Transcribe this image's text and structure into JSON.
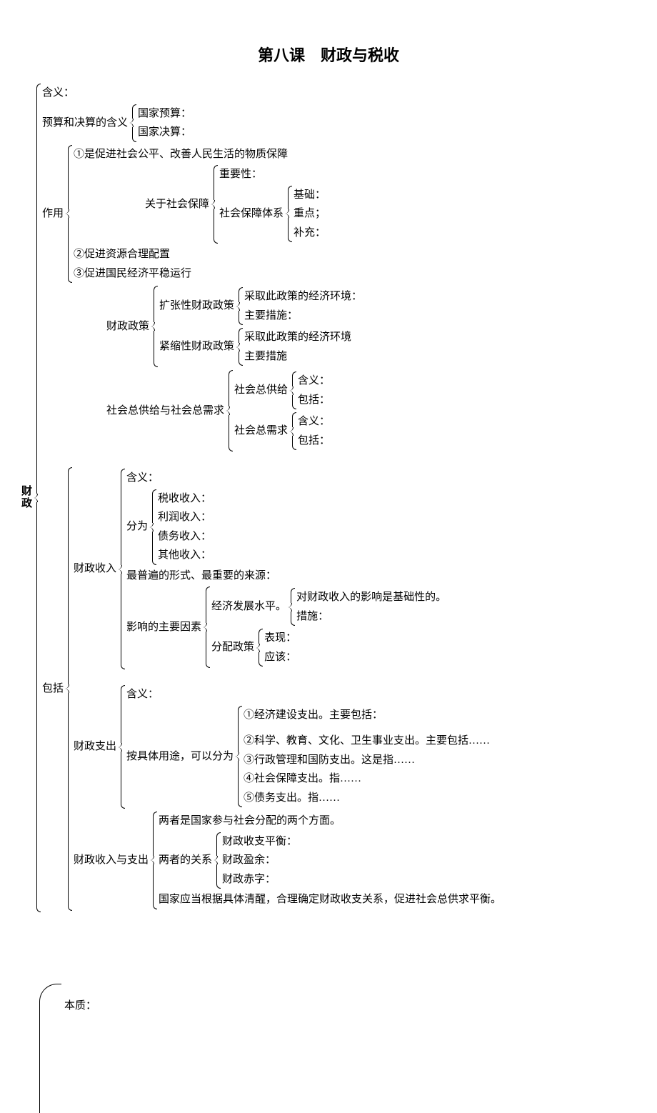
{
  "title": "第八课　财政与税收",
  "root": "财政",
  "s1": {
    "meaning": "含义：",
    "budget": {
      "label": "预算和决算的含义",
      "a": "国家预算：",
      "b": "国家决算："
    },
    "role": {
      "label": "作用",
      "r1": "①是促进社会公平、改善人民生活的物质保障",
      "ss": {
        "label": "关于社会保障",
        "imp": "重要性：",
        "sys": {
          "label": "社会保障体系",
          "a": "基础：",
          "b": "重点；",
          "c": "补充："
        }
      },
      "r2": "②促进资源合理配置",
      "r3": "③促进国民经济平稳运行"
    },
    "policy": {
      "label": "财政政策",
      "exp": {
        "label": "扩张性财政政策",
        "a": "采取此政策的经济环境：",
        "b": "主要措施："
      },
      "con": {
        "label": "紧缩性财政政策",
        "a": "采取此政策的经济环境",
        "b": "主要措施"
      }
    },
    "sd": {
      "label": "社会总供给与社会总需求",
      "supply": {
        "label": "社会总供给",
        "a": "含义：",
        "b": "包括："
      },
      "demand": {
        "label": "社会总需求",
        "a": "含义：",
        "b": "包括："
      }
    }
  },
  "s2": {
    "label": "包括",
    "income": {
      "label": "财政收入",
      "meaning": "含义：",
      "types": {
        "label": "分为",
        "a": "税收收入：",
        "b": "利润收入：",
        "c": "债务收入：",
        "d": "其他收入："
      },
      "main": "最普遍的形式、最重要的来源：",
      "factors": {
        "label": "影响的主要因素",
        "eco": {
          "label": "经济发展水平。",
          "a": "对财政收入的影响是基础性的。",
          "b": "措施："
        },
        "dist": {
          "label": "分配政策",
          "a": "表现：",
          "b": "应该："
        }
      }
    },
    "expense": {
      "label": "财政支出",
      "meaning": "含义：",
      "use": {
        "label": "按具体用途，可以分为",
        "a": "①经济建设支出。主要包括：",
        "b": "②科学、教育、文化、卫生事业支出。主要包括……",
        "c": "③行政管理和国防支出。这是指……",
        "d": "④社会保障支出。指……",
        "e": "⑤债务支出。指……"
      }
    },
    "both": {
      "label": "财政收入与支出",
      "a": "两者是国家参与社会分配的两个方面。",
      "rel": {
        "label": "两者的关系",
        "a": "财政收支平衡：",
        "b": "财政盈余：",
        "c": "财政赤字："
      },
      "c": "国家应当根据具体清醒，合理确定财政收支关系，促进社会总供求平衡。"
    }
  },
  "bottom": {
    "essence": "本质："
  }
}
